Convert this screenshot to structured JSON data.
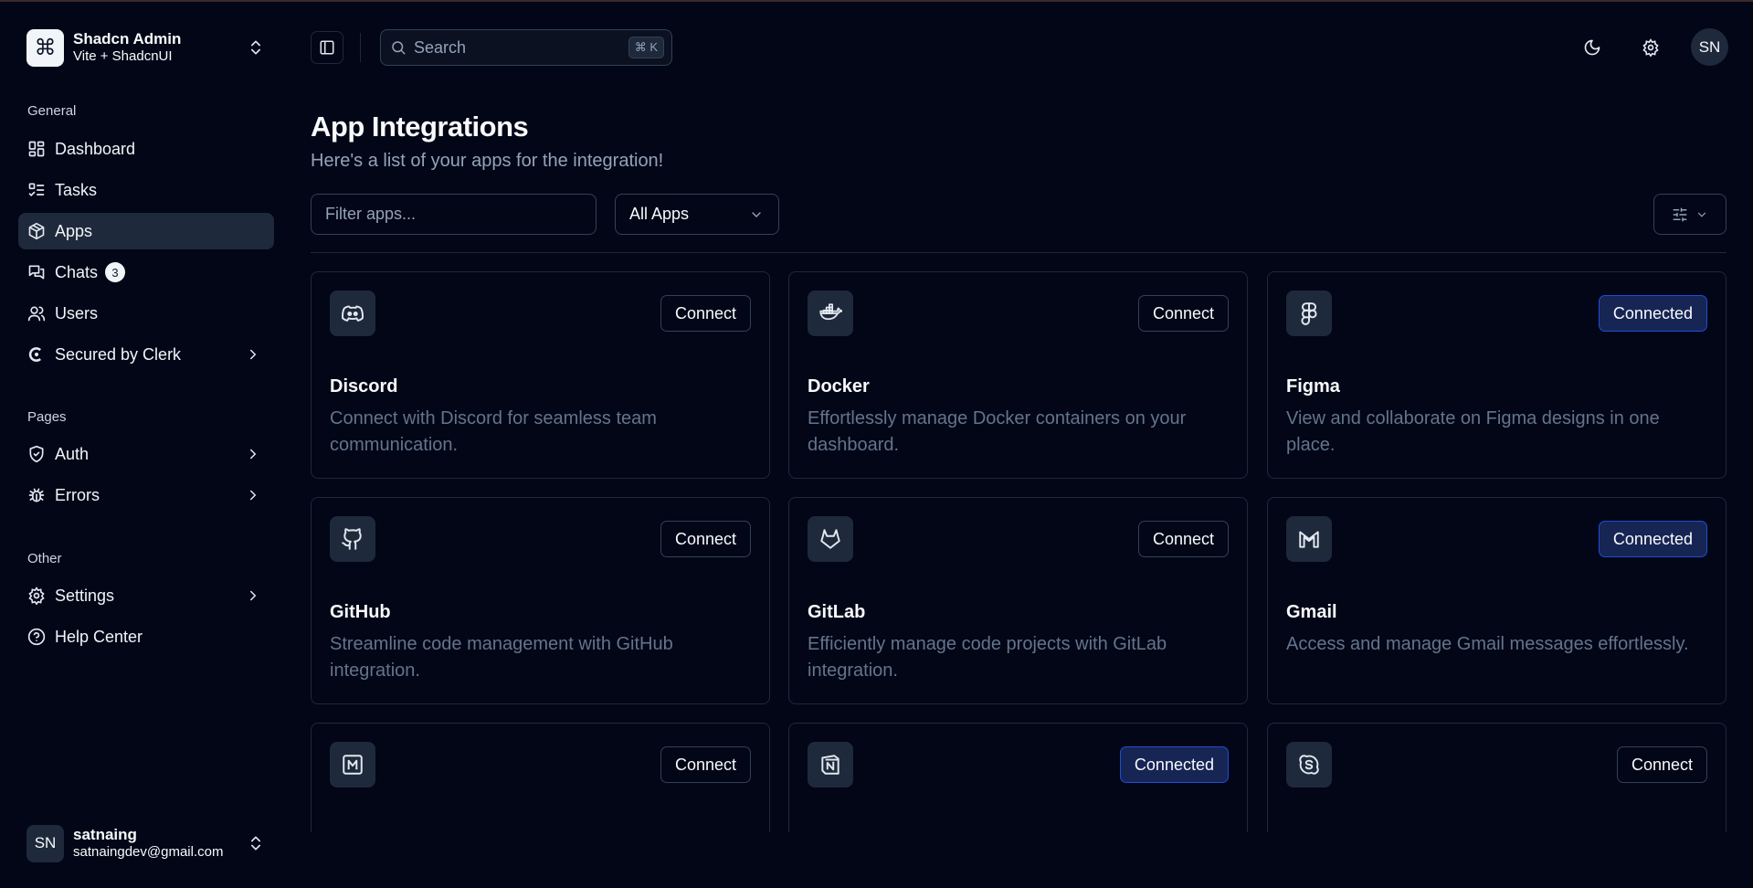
{
  "sidebar": {
    "team": {
      "name": "Shadcn Admin",
      "sub": "Vite + ShadcnUI",
      "logo_icon": "command-icon"
    },
    "groups": {
      "general": "General",
      "pages": "Pages",
      "other": "Other"
    },
    "items": [
      {
        "label": "Dashboard",
        "icon": "layout-dashboard-icon"
      },
      {
        "label": "Tasks",
        "icon": "list-todo-icon"
      },
      {
        "label": "Apps",
        "icon": "package-icon",
        "active": true
      },
      {
        "label": "Chats",
        "icon": "messages-icon",
        "badge": "3"
      },
      {
        "label": "Users",
        "icon": "users-icon"
      },
      {
        "label": "Secured by Clerk",
        "icon": "clerk-icon"
      },
      {
        "label": "Auth",
        "icon": "shield-check-icon"
      },
      {
        "label": "Errors",
        "icon": "bug-icon"
      },
      {
        "label": "Settings",
        "icon": "gear-icon"
      },
      {
        "label": "Help Center",
        "icon": "help-circle-icon"
      }
    ],
    "user": {
      "initials": "SN",
      "name": "satnaing",
      "email": "satnaingdev@gmail.com"
    }
  },
  "header": {
    "search_placeholder": "Search",
    "search_shortcut": "⌘ K",
    "avatar_initials": "SN"
  },
  "main": {
    "title": "App Integrations",
    "description": "Here's a list of your apps for the integration!",
    "filter_placeholder": "Filter apps...",
    "type_select": "All Apps",
    "apps": [
      {
        "name": "Discord",
        "desc": "Connect with Discord for seamless team communication.",
        "button": "Connect",
        "connected": false,
        "icon": "discord-icon"
      },
      {
        "name": "Docker",
        "desc": "Effortlessly manage Docker containers on your dashboard.",
        "button": "Connect",
        "connected": false,
        "icon": "docker-icon"
      },
      {
        "name": "Figma",
        "desc": "View and collaborate on Figma designs in one place.",
        "button": "Connected",
        "connected": true,
        "icon": "figma-icon"
      },
      {
        "name": "GitHub",
        "desc": "Streamline code management with GitHub integration.",
        "button": "Connect",
        "connected": false,
        "icon": "github-icon"
      },
      {
        "name": "GitLab",
        "desc": "Efficiently manage code projects with GitLab integration.",
        "button": "Connect",
        "connected": false,
        "icon": "gitlab-icon"
      },
      {
        "name": "Gmail",
        "desc": "Access and manage Gmail messages effortlessly.",
        "button": "Connected",
        "connected": true,
        "icon": "gmail-icon"
      },
      {
        "button": "Connect",
        "connected": false,
        "icon": "medium-icon"
      },
      {
        "button": "Connected",
        "connected": true,
        "icon": "notion-icon"
      },
      {
        "button": "Connect",
        "connected": false,
        "icon": "skype-icon"
      }
    ]
  },
  "colors": {
    "background": "#020617",
    "surface": "#1e293b",
    "border": "#334155",
    "muted_text": "#94a3b8",
    "connected_bg": "#172554",
    "connected_border": "#1d4ed8"
  }
}
